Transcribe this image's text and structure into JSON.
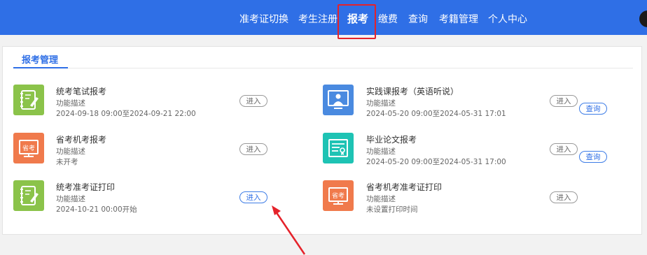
{
  "nav": {
    "items": [
      "准考证切换",
      "考生注册",
      "报考",
      "缴费",
      "查询",
      "考籍管理",
      "个人中心"
    ]
  },
  "tab": {
    "title": "报考管理"
  },
  "cards": [
    {
      "title": "统考笔试报考",
      "desc": "功能描述",
      "time": "2024-09-18 09:00至2024-09-21 22:00",
      "enter": "进入",
      "icon": "notebook-pen-icon"
    },
    {
      "title": "省考机考报考",
      "desc": "功能描述",
      "time": "未开考",
      "enter": "进入",
      "icon": "monitor-exam-icon"
    },
    {
      "title": "统考准考证打印",
      "desc": "功能描述",
      "time": "2024-10-21 00:00开始",
      "enter": "进入",
      "icon": "notebook-pen-icon"
    },
    {
      "title": "实践课报考（英语听说）",
      "desc": "功能描述",
      "time": "2024-05-20 09:00至2024-05-31 17:01",
      "enter": "进入",
      "query": "查询",
      "icon": "presentation-screen-icon"
    },
    {
      "title": "毕业论文报考",
      "desc": "功能描述",
      "time": "2024-05-20 09:00至2024-05-31 17:00",
      "enter": "进入",
      "query": "查询",
      "icon": "certificate-icon"
    },
    {
      "title": "省考机考准考证打印",
      "desc": "功能描述",
      "time": "未设置打印时间",
      "enter": "进入",
      "icon": "monitor-exam-icon"
    }
  ],
  "colors": {
    "nav_bg": "#2f6fe6",
    "highlight": "#e5222a",
    "green_icon": "#8bc34a",
    "orange_icon": "#f07a4c",
    "blue_icon": "#4a8ae0",
    "teal_icon": "#1ec3b4"
  }
}
